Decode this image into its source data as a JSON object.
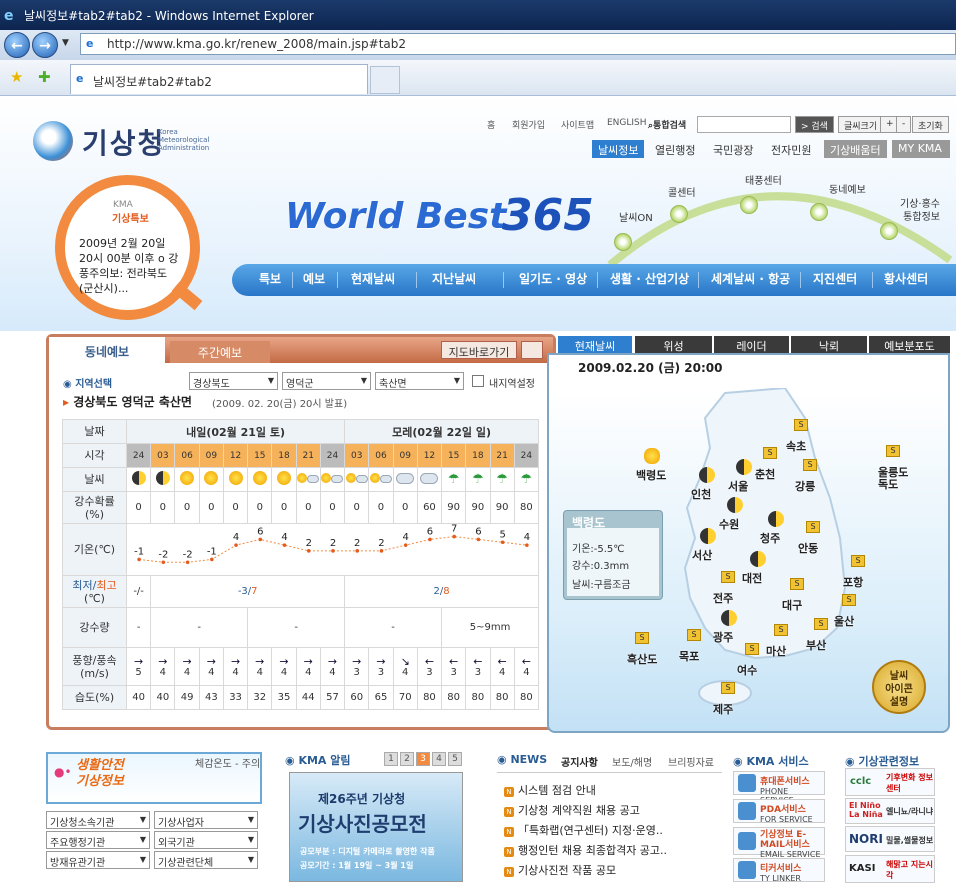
{
  "browser": {
    "title": "날씨정보#tab2#tab2 - Windows Internet Explorer",
    "url": "http://www.kma.go.kr/renew_2008/main.jsp#tab2",
    "tab_title": "날씨정보#tab2#tab2"
  },
  "header": {
    "logo_text": "기상청",
    "logo_sub": "Korea Meteorological Administration",
    "util_links": [
      "홈",
      "회원가입",
      "사이트맵",
      "ENGLISH"
    ],
    "search_label": "통합검색",
    "search_button": "> 검색",
    "font_size_label": "글씨크기",
    "font_plus": "+",
    "font_minus": "-",
    "font_reset": "초기화",
    "main_nav": [
      "날씨정보",
      "열린행정",
      "국민광장",
      "전자민원"
    ],
    "main_nav_right": [
      "기상배움터",
      "MY KMA"
    ],
    "slogan": "World Best",
    "slogan_num": "365",
    "arc_items": [
      "날씨ON",
      "콜센터",
      "태풍센터",
      "동네예보",
      "기상·홍수\n통합정보"
    ],
    "kma_notice_tag": "KMA",
    "kma_notice_title": "기상특보",
    "kma_notice_body": "2009년 2월 20일 20시 00분 이후 o 강풍주의보: 전라북도(군산시)...",
    "menu": [
      "특보",
      "예보",
      "현재날씨",
      "지난날씨",
      "일기도 · 영상",
      "생활 · 산업기상",
      "세계날씨 · 항공",
      "지진센터",
      "황사센터"
    ]
  },
  "forecast": {
    "tab_active": "동네예보",
    "tab_other": "주간예보",
    "map_button": "지도바로가기",
    "region_label": "지역선택",
    "sel_province": "경상북도",
    "sel_county": "영덕군",
    "sel_town": "축산면",
    "my_region": "내지역설정",
    "location": "경상북도 영덕군 축산면",
    "location_sub": "(2009. 02. 20(금) 20시 발표)",
    "row_labels": {
      "date": "날짜",
      "time": "시각",
      "weather": "날씨",
      "pop": "강수확률\n(%)",
      "temp": "기온(℃)",
      "minmax_a": "최저/",
      "minmax_b": "최고",
      "minmax_c": "(℃)",
      "rain": "강수량",
      "wind": "풍향/풍속\n(m/s)",
      "humidity": "습도(%)"
    },
    "day1": "내일(02월 21일 토)",
    "day2": "모레(02월 22일 일)",
    "times": [
      "24",
      "03",
      "06",
      "09",
      "12",
      "15",
      "18",
      "21",
      "24",
      "03",
      "06",
      "09",
      "12",
      "15",
      "18",
      "21",
      "24"
    ],
    "weather": [
      "moon",
      "moon",
      "sun",
      "sun",
      "sun",
      "sun",
      "sun",
      "suncloud",
      "suncloud",
      "suncloud",
      "suncloud",
      "cloud",
      "cloud",
      "rain",
      "rain",
      "rain",
      "rain"
    ],
    "pop": [
      "0",
      "0",
      "0",
      "0",
      "0",
      "0",
      "0",
      "0",
      "0",
      "0",
      "0",
      "0",
      "60",
      "90",
      "90",
      "90",
      "80"
    ],
    "temps": [
      -1,
      -2,
      -2,
      -1,
      4,
      6,
      4,
      2,
      2,
      2,
      2,
      4,
      6,
      7,
      6,
      5,
      4
    ],
    "temp_labels": [
      "-1",
      "-2",
      "-2",
      "-1",
      "4",
      "6",
      "4",
      "2",
      "2",
      "2",
      "2",
      "4",
      "6",
      "7",
      "6",
      "5",
      "4"
    ],
    "minmax_first": "-/-",
    "minmax_day1_min": "-3/",
    "minmax_day1_max": "7",
    "minmax_day2_min": "2/",
    "minmax_day2_max": "8",
    "rain": [
      "-",
      "-",
      "-",
      "-",
      "5~9mm"
    ],
    "wind_dir": [
      "→",
      "→",
      "→",
      "→",
      "→",
      "→",
      "→",
      "→",
      "→",
      "→",
      "→",
      "↘",
      "←",
      "←",
      "←",
      "←",
      "←"
    ],
    "wind_speed": [
      "5",
      "4",
      "4",
      "4",
      "4",
      "4",
      "4",
      "4",
      "4",
      "3",
      "3",
      "4",
      "3",
      "3",
      "3",
      "4",
      "4"
    ],
    "humidity": [
      "40",
      "40",
      "49",
      "43",
      "33",
      "32",
      "35",
      "44",
      "57",
      "60",
      "65",
      "70",
      "80",
      "80",
      "80",
      "80",
      "80"
    ]
  },
  "nowpanel": {
    "tabs": [
      "현재날씨",
      "위성",
      "레이더",
      "낙뢰",
      "예보분포도"
    ],
    "datetime": "2009.02.20 (금) 20:00",
    "info_title": "백령도",
    "info_temp": "기온:-5.5℃",
    "info_rain": "강수:0.3mm",
    "info_weather": "날씨:구름조금",
    "cities": [
      "백령도",
      "인천",
      "서울",
      "춘천",
      "속초",
      "강릉",
      "울릉도\n독도",
      "수원",
      "청주",
      "안동",
      "서산",
      "대전",
      "포항",
      "전주",
      "대구",
      "울산",
      "광주",
      "마산",
      "부산",
      "흑산도",
      "목포",
      "여수",
      "제주"
    ],
    "badge": "S",
    "icon_button": "날씨\n아이콘\n설명"
  },
  "bottom": {
    "safety_title": "생활안전\n기상정보",
    "safety_right": "체감온도 - 주의",
    "selects": [
      "기상청소속기관",
      "기상사업자",
      "주요행정기관",
      "외국기관",
      "방재유관기관",
      "기상관련단체"
    ],
    "kma_notice": "KMA 알림",
    "pages": [
      "1",
      "2",
      "3",
      "4",
      "5"
    ],
    "poster_top": "제26주년 기상청",
    "poster_main": "기상사진공모전",
    "poster_l1": "공모부분 : 디지털 카메라로 촬영한 작품",
    "poster_l2": "공모기간 : 1월 19일 ~ 3월 1일",
    "news_title": "NEWS",
    "news_tabs": [
      "공지사항",
      "보도/해명",
      "브리핑자료"
    ],
    "news_items": [
      "시스템 점검 안내",
      "기상청 계약직원 채용 공고",
      "「특화랩(연구센터) 지정·운영..",
      "행정인턴 채용 최종합격자 공고..",
      "기상사진전 작품 공모"
    ],
    "service_title": "KMA 서비스",
    "services": [
      "휴대폰서비스",
      "PDA서비스",
      "기상정보 E-MAIL서비스",
      "티커서비스"
    ],
    "services_sub": [
      "PHONE SERVICE",
      "FOR SERVICE",
      "EMAIL SERVICE",
      "TY LINKER"
    ],
    "related_title": "기상관련정보",
    "related": [
      "기후변화 정보센터",
      "엘니뇨/라니냐",
      "밀물,썰물정보",
      "해맑고 지는시각"
    ],
    "related_logos": [
      "cclc",
      "El Niño La Niña",
      "NORI",
      "KASI"
    ]
  },
  "colors": {
    "accent": "#2876c8",
    "orange": "#f28b3f",
    "panel_border": "#c87e5e"
  }
}
